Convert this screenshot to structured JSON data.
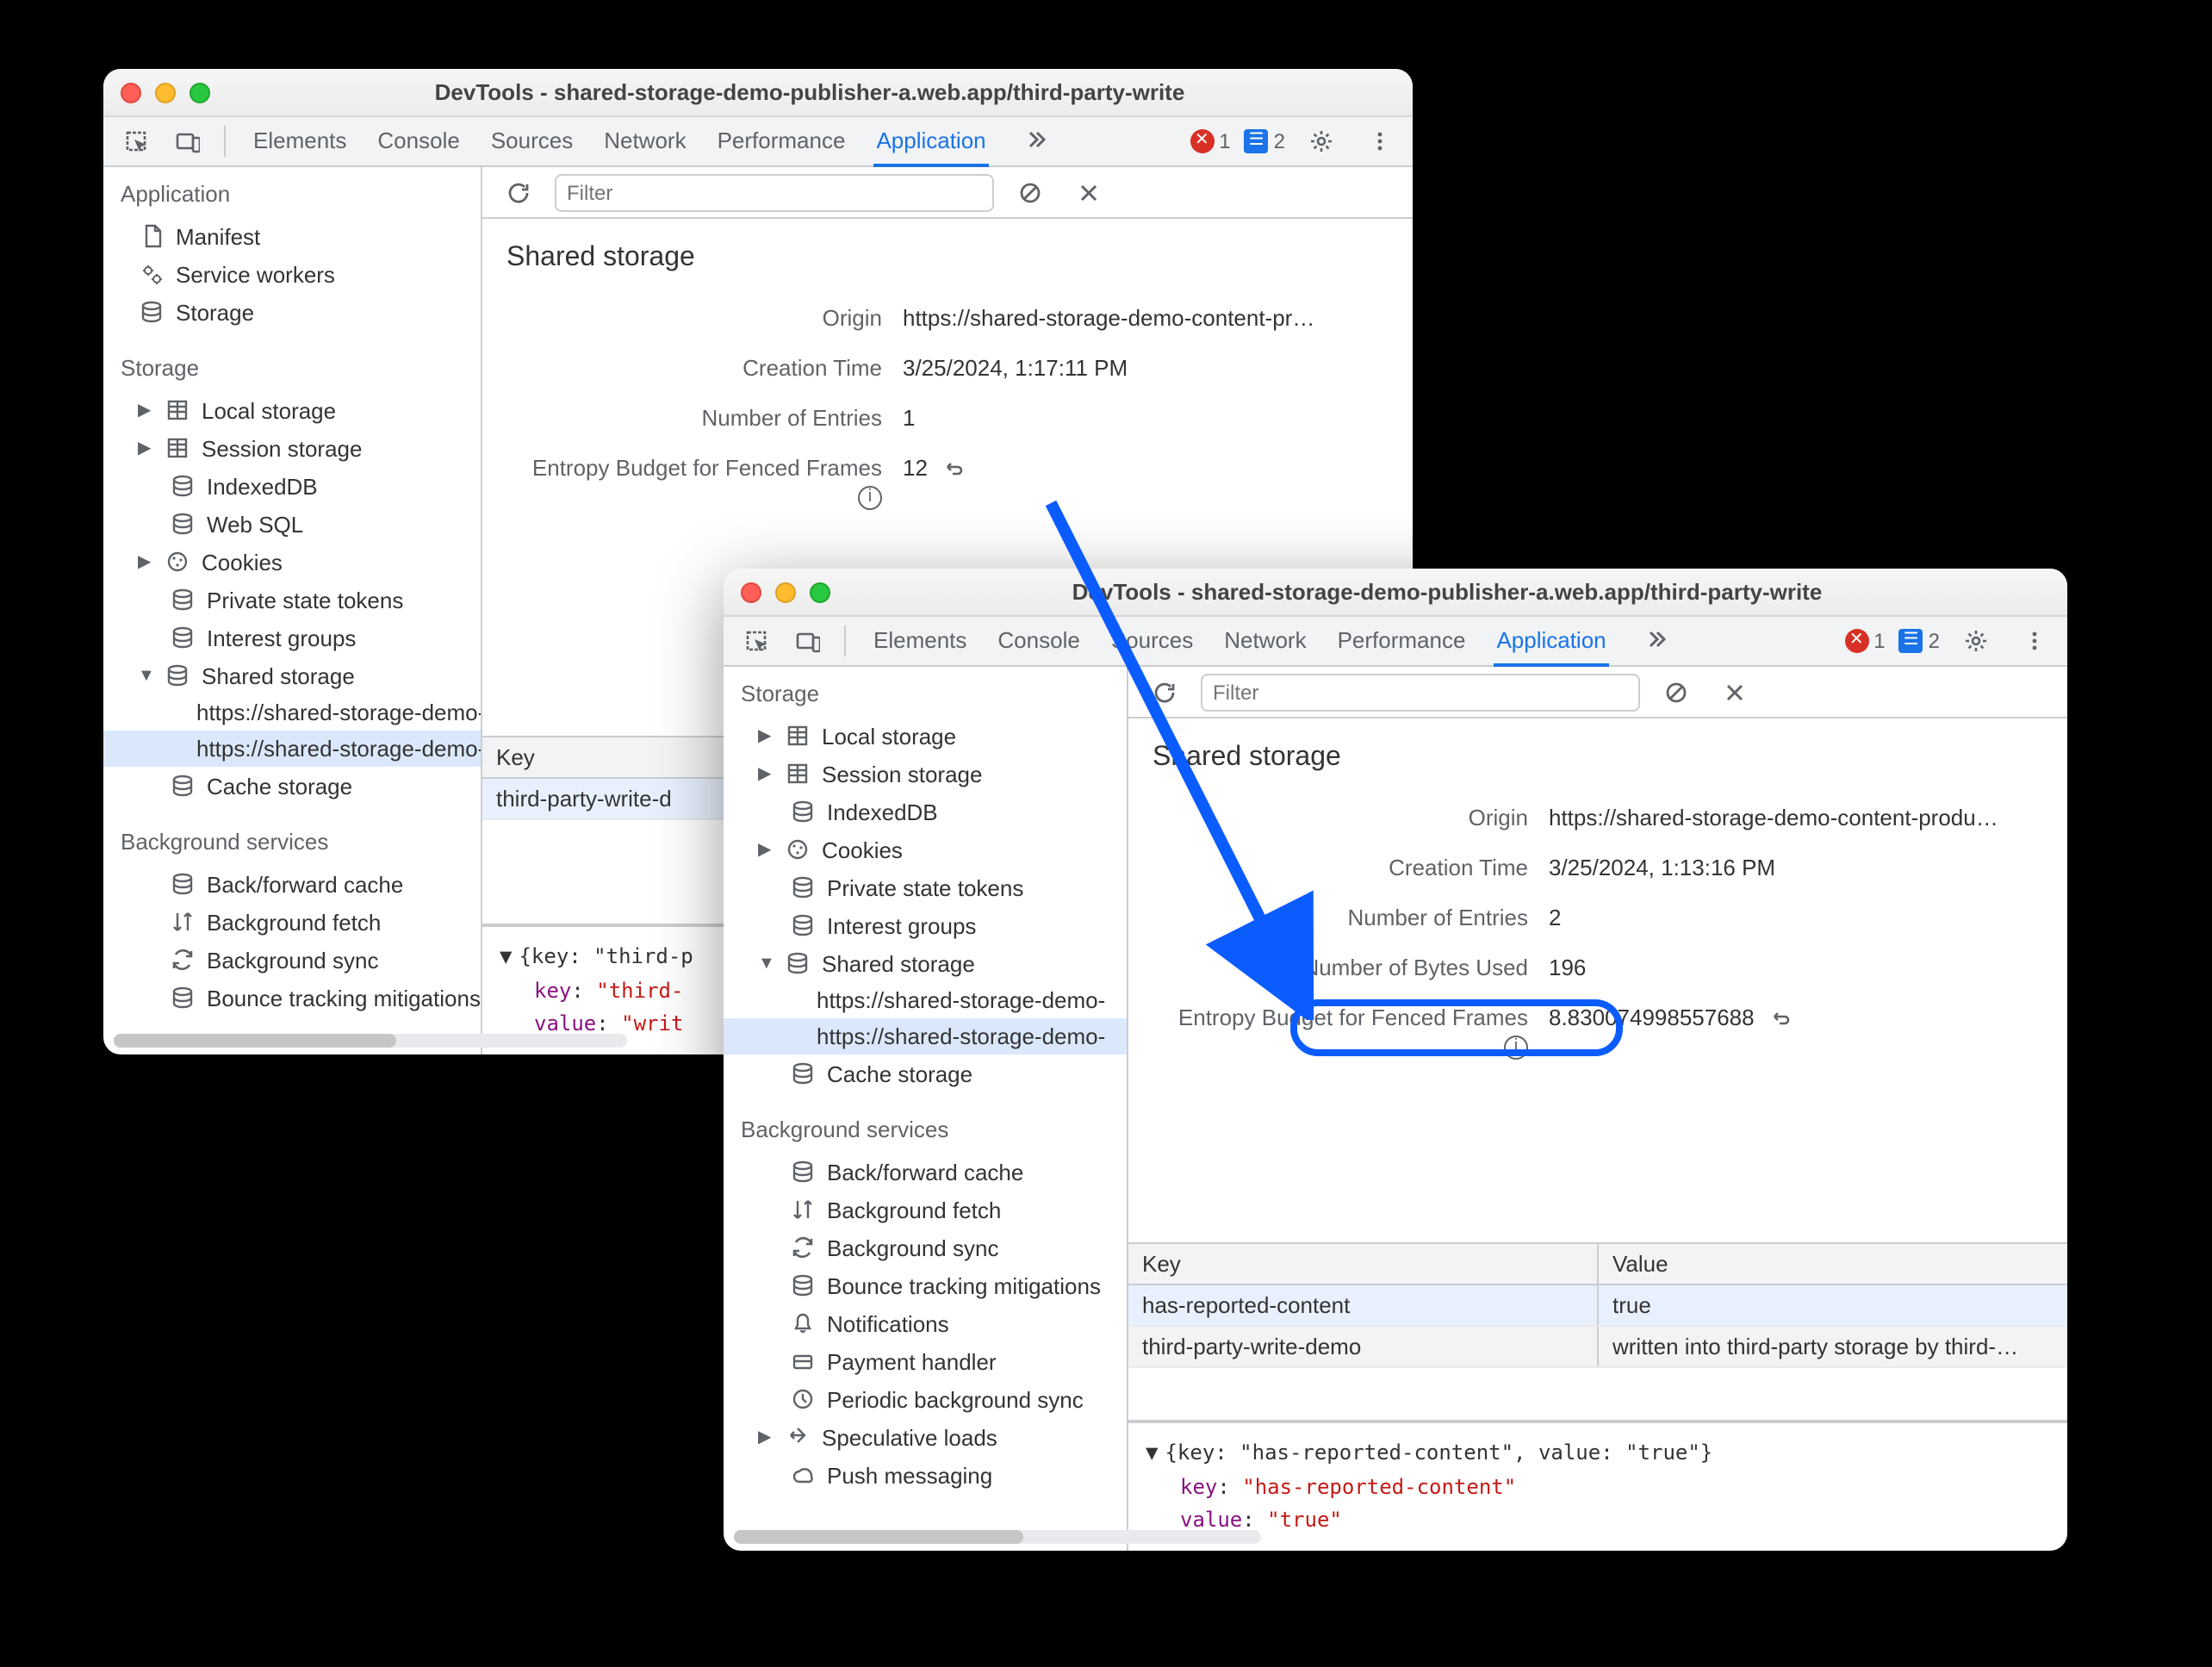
{
  "window1": {
    "title": "DevTools - shared-storage-demo-publisher-a.web.app/third-party-write",
    "tabs": [
      "Elements",
      "Console",
      "Sources",
      "Network",
      "Performance",
      "Application"
    ],
    "active_tab": "Application",
    "errors": 1,
    "infos": 2,
    "filter_placeholder": "Filter",
    "sidebar": {
      "application_header": "Application",
      "app_items": {
        "manifest": "Manifest",
        "service_workers": "Service workers",
        "storage": "Storage"
      },
      "storage_header": "Storage",
      "storage_items": {
        "local": "Local storage",
        "session": "Session storage",
        "indexeddb": "IndexedDB",
        "websql": "Web SQL",
        "cookies": "Cookies",
        "pst": "Private state tokens",
        "interest": "Interest groups",
        "shared": "Shared storage",
        "shared_sub1": "https://shared-storage-demo-",
        "shared_sub2": "https://shared-storage-demo-",
        "cache": "Cache storage"
      },
      "bg_header": "Background services",
      "bg_items": {
        "bfcache": "Back/forward cache",
        "bgfetch": "Background fetch",
        "bgsync": "Background sync",
        "bounce": "Bounce tracking mitigations"
      }
    },
    "panel": {
      "heading": "Shared storage",
      "origin_label": "Origin",
      "origin_value": "https://shared-storage-demo-content-pr…",
      "ctime_label": "Creation Time",
      "ctime_value": "3/25/2024, 1:17:11 PM",
      "entries_label": "Number of Entries",
      "entries_value": "1",
      "entropy_label": "Entropy Budget for Fenced Frames",
      "entropy_value": "12",
      "th_key": "Key",
      "row1": "third-party-write-d",
      "json_line": "{key: \"third-p",
      "json_key": "\"third-",
      "json_val": "\"writ"
    }
  },
  "window2": {
    "title": "DevTools - shared-storage-demo-publisher-a.web.app/third-party-write",
    "tabs": [
      "Elements",
      "Console",
      "Sources",
      "Network",
      "Performance",
      "Application"
    ],
    "active_tab": "Application",
    "errors": 1,
    "infos": 2,
    "filter_placeholder": "Filter",
    "sidebar": {
      "storage_header": "Storage",
      "storage_items": {
        "local": "Local storage",
        "session": "Session storage",
        "indexeddb": "IndexedDB",
        "cookies": "Cookies",
        "pst": "Private state tokens",
        "interest": "Interest groups",
        "shared": "Shared storage",
        "shared_sub1": "https://shared-storage-demo-",
        "shared_sub2": "https://shared-storage-demo-",
        "cache": "Cache storage"
      },
      "bg_header": "Background services",
      "bg_items": {
        "bfcache": "Back/forward cache",
        "bgfetch": "Background fetch",
        "bgsync": "Background sync",
        "bounce": "Bounce tracking mitigations",
        "notif": "Notifications",
        "payment": "Payment handler",
        "periodic": "Periodic background sync",
        "spec": "Speculative loads",
        "push": "Push messaging"
      }
    },
    "panel": {
      "heading": "Shared storage",
      "origin_label": "Origin",
      "origin_value": "https://shared-storage-demo-content-produ…",
      "ctime_label": "Creation Time",
      "ctime_value": "3/25/2024, 1:13:16 PM",
      "entries_label": "Number of Entries",
      "entries_value": "2",
      "bytes_label": "Number of Bytes Used",
      "bytes_value": "196",
      "entropy_label": "Entropy Budget for Fenced Frames",
      "entropy_value": "8.830074998557688",
      "th_key": "Key",
      "th_value": "Value",
      "rows": [
        {
          "k": "has-reported-content",
          "v": "true"
        },
        {
          "k": "third-party-write-demo",
          "v": "written into third-party storage by third-…"
        }
      ],
      "json_line": "{key: \"has-reported-content\", value: \"true\"}",
      "json_key": "\"has-reported-content\"",
      "json_val": "\"true\""
    }
  }
}
